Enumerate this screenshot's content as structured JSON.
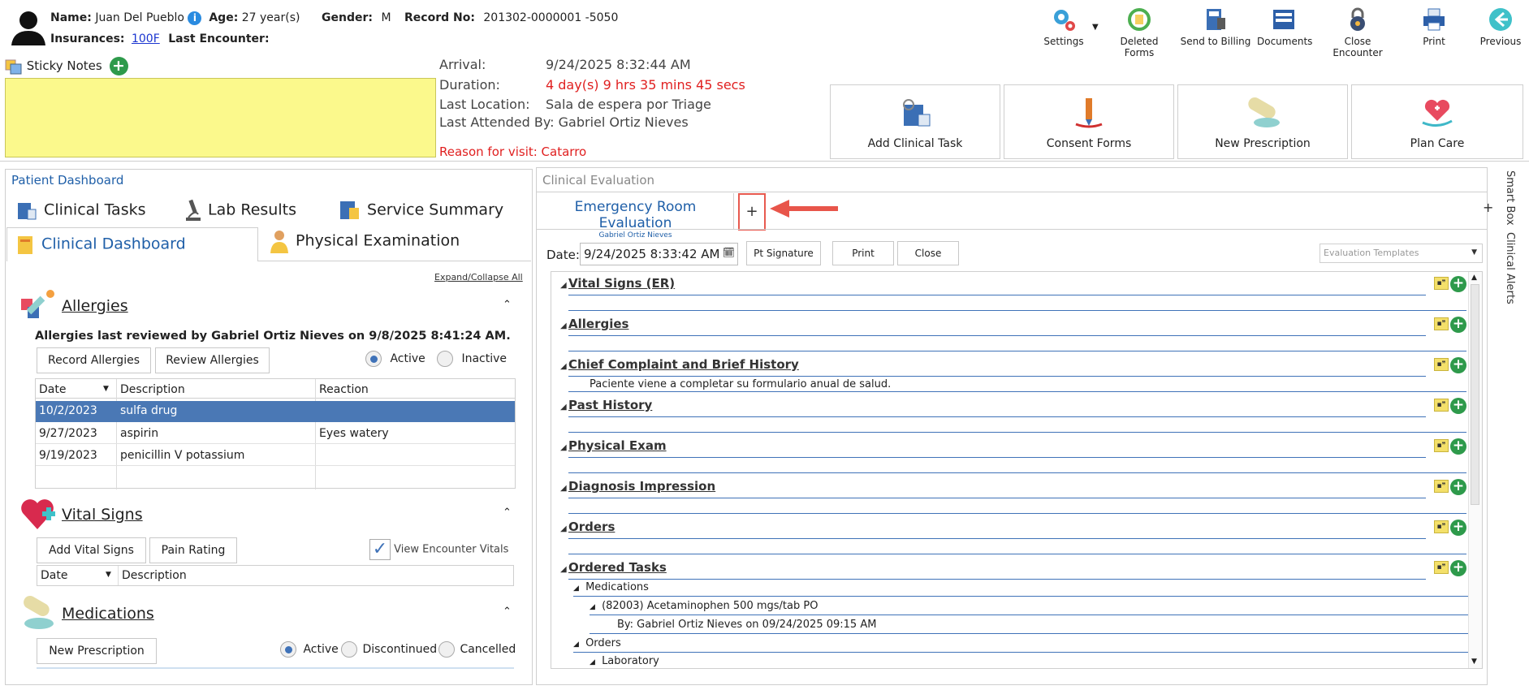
{
  "patient": {
    "name_label": "Name:",
    "name": "Juan Del Pueblo",
    "age_label": "Age:",
    "age": "27 year(s)",
    "gender_label": "Gender:",
    "gender": "M",
    "record_label": "Record No:",
    "record": "201302-0000001 -5050",
    "insurances_label": "Insurances:",
    "insurance": "100F",
    "last_encounter_label": "Last Encounter:"
  },
  "sticky_notes": {
    "label": "Sticky Notes"
  },
  "encounter": {
    "arrival_label": "Arrival:",
    "arrival": "9/24/2025 8:32:44 AM",
    "duration_label": "Duration:",
    "duration": "4 day(s) 9 hrs 35 mins 45 secs",
    "location_label": "Last Location:",
    "location": "Sala de espera por Triage",
    "attended_label": "Last Attended By:",
    "attended": "Gabriel Ortiz Nieves",
    "reason": "Reason for visit: Catarro"
  },
  "toolbar": {
    "settings": "Settings",
    "deleted_forms": "Deleted Forms",
    "send_billing": "Send to Billing",
    "documents": "Documents",
    "close_encounter": "Close Encounter",
    "print": "Print",
    "previous": "Previous"
  },
  "tiles": {
    "add_clinical_task": "Add Clinical Task",
    "consent_forms": "Consent Forms",
    "new_prescription": "New Prescription",
    "plan_care": "Plan Care"
  },
  "dashboard": {
    "title": "Patient Dashboard",
    "tabs": {
      "clinical_tasks": "Clinical Tasks",
      "lab_results": "Lab Results",
      "service_summary": "Service Summary",
      "clinical_dashboard": "Clinical Dashboard",
      "physical_exam": "Physical Examination"
    },
    "expand_collapse": "Expand/Collapse All",
    "allergies": {
      "title": "Allergies",
      "reviewed": "Allergies last reviewed by Gabriel Ortiz Nieves on 9/8/2025 8:41:24 AM.",
      "record_btn": "Record Allergies",
      "review_btn": "Review Allergies",
      "active": "Active",
      "inactive": "Inactive",
      "columns": [
        "Date",
        "Description",
        "Reaction"
      ],
      "rows": [
        {
          "date": "10/2/2023",
          "description": "sulfa drug",
          "reaction": ""
        },
        {
          "date": "9/27/2023",
          "description": "aspirin",
          "reaction": "Eyes watery"
        },
        {
          "date": "9/19/2023",
          "description": "penicillin V potassium",
          "reaction": ""
        }
      ]
    },
    "vitals": {
      "title": "Vital Signs",
      "add_btn": "Add Vital Signs",
      "pain_btn": "Pain Rating",
      "view_encounter": "View Encounter Vitals",
      "columns": [
        "Date",
        "Description"
      ]
    },
    "medications": {
      "title": "Medications",
      "new_btn": "New Prescription",
      "active": "Active",
      "discontinued": "Discontinued",
      "cancelled": "Cancelled"
    }
  },
  "evaluation": {
    "header": "Clinical Evaluation",
    "tab_title": "Emergency Room Evaluation",
    "tab_sub": "Gabriel Ortiz Nieves",
    "add_tab": "+",
    "right_plus": "+",
    "date_label": "Date:",
    "date_value": "9/24/2025 8:33:42 AM",
    "pt_signature": "Pt Signature",
    "print": "Print",
    "close": "Close",
    "templates_placeholder": "Evaluation Templates",
    "sections": [
      {
        "title": "Vital Signs (ER)",
        "note": ""
      },
      {
        "title": "Allergies",
        "note": ""
      },
      {
        "title": "Chief Complaint and Brief History",
        "note": "Paciente viene a completar su formulario anual de salud."
      },
      {
        "title": "Past History",
        "note": ""
      },
      {
        "title": "Physical Exam",
        "note": ""
      },
      {
        "title": "Diagnosis Impression",
        "note": ""
      },
      {
        "title": "Orders",
        "note": ""
      },
      {
        "title": "Ordered Tasks",
        "note": ""
      }
    ],
    "ordered_tasks": {
      "medications": "Medications",
      "med_item": "(82003) Acetaminophen 500 mgs/tab PO",
      "med_by": "By: Gabriel Ortiz Nieves on 09/24/2025 09:15 AM",
      "orders": "Orders",
      "laboratory": "Laboratory"
    }
  },
  "side_tabs": {
    "smart_box": "Smart Box",
    "clinical_alerts": "Clinical Alerts"
  },
  "colors": {
    "accent": "#1f5fa8",
    "selected_row": "#4a78b5",
    "sticky": "#fbf98c",
    "red": "#e02020"
  }
}
